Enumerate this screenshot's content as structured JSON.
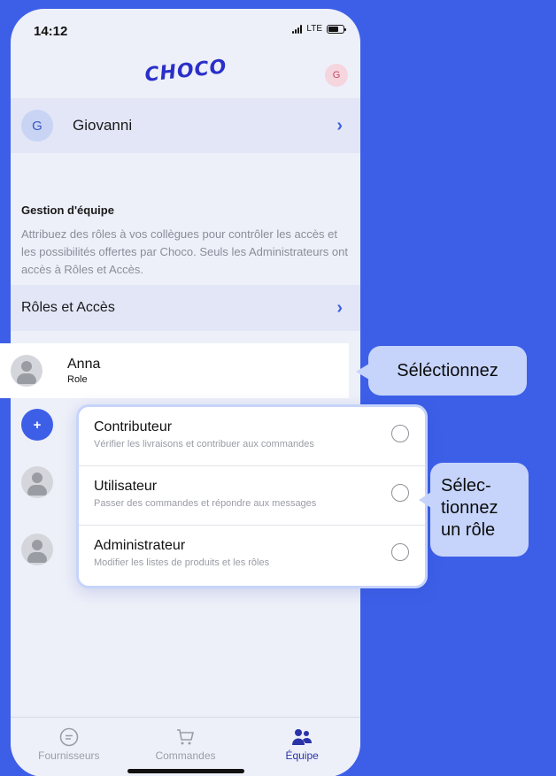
{
  "status_bar": {
    "time": "14:12",
    "network": "LTE"
  },
  "header": {
    "logo": "CHOCO",
    "avatar_initial": "G"
  },
  "profile": {
    "initial": "G",
    "name": "Giovanni"
  },
  "team_section": {
    "title": "Gestion d'équipe",
    "description": "Attribuez des rôles à vos collègues pour contrôler les accès et les possibilités offertes par Choco. Seuls les Administrateurs ont accès à Rôles et Accès."
  },
  "roles_access": {
    "label": "Rôles et Accès"
  },
  "selected_member": {
    "name": "Anna",
    "role": "Role"
  },
  "role_options": [
    {
      "name": "Contributeur",
      "description": "Vérifier les livraisons et contribuer aux commandes"
    },
    {
      "name": "Utilisateur",
      "description": "Passer des commandes et répondre aux messages"
    },
    {
      "name": "Administrateur",
      "description": "Modifier les listes de produits et les rôles"
    }
  ],
  "tabs": [
    {
      "label": "Fournisseurs",
      "icon": "chat-icon",
      "active": false
    },
    {
      "label": "Commandes",
      "icon": "cart-icon",
      "active": false
    },
    {
      "label": "Équipe",
      "icon": "team-icon",
      "active": true
    }
  ],
  "callouts": {
    "select_member": "Séléctionnez",
    "select_role_lines": [
      "Sélec-",
      "tionnez",
      "un rôle"
    ]
  },
  "colors": {
    "accent": "#3d5fe8",
    "background": "#3d5fe8",
    "callout": "#c6d4fb",
    "active_tab": "#2a33a8"
  }
}
